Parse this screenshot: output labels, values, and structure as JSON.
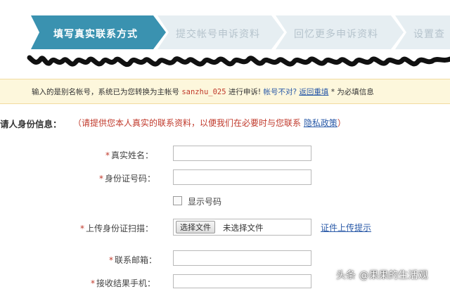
{
  "steps": [
    {
      "label": "填写真实联系方式",
      "state": "active"
    },
    {
      "label": "提交帐号申诉资料",
      "state": "inactive"
    },
    {
      "label": "回忆更多申诉资料",
      "state": "inactive"
    },
    {
      "label": "设置查",
      "state": "inactive"
    }
  ],
  "notice": {
    "prefix": "输入的是别名帐号，系统已为您转换为主帐号 ",
    "username": "sanzhu_025",
    "middle": " 进行申诉! ",
    "wrong_account": "帐号不对?",
    "return_link": "返回重填",
    "suffix": " * 为必填信息"
  },
  "section": {
    "title": "请人身份信息：",
    "hint_prefix": "（请提供您本人真实的联系资料，以便我们在必要时与您联系 ",
    "privacy_link": "隐私政策",
    "hint_suffix": "）"
  },
  "form": {
    "real_name_label": "真实姓名：",
    "id_number_label": "身份证号码：",
    "show_number_label": "显示号码",
    "id_scan_label": "上传身份证扫描：",
    "file_button": "选择文件",
    "file_status": "未选择文件",
    "upload_tip": "证件上传提示",
    "email_label": "联系邮箱：",
    "phone_label": "接收结果手机：",
    "required_mark": "*"
  },
  "watermark": "头条 @果果的生活观",
  "colors": {
    "active_step": "#3a92b0",
    "inactive_step": "#e6eef2",
    "required": "#c0392b",
    "link": "#2a5aa8",
    "notice_bg": "#fdf7dc"
  }
}
